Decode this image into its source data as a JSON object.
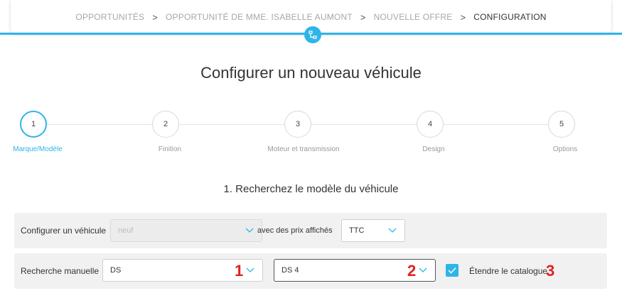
{
  "breadcrumb": {
    "items": [
      "OPPORTUNITÉS",
      "OPPORTUNITÉ DE MME. ISABELLE AUMONT",
      "NOUVELLE OFFRE",
      "CONFIGURATION"
    ],
    "separator": ">"
  },
  "page": {
    "title": "Configurer un nouveau véhicule"
  },
  "stepper": {
    "steps": [
      {
        "number": "1",
        "label": "Marque/Modèle",
        "active": true
      },
      {
        "number": "2",
        "label": "Finition",
        "active": false
      },
      {
        "number": "3",
        "label": "Moteur et transmission",
        "active": false
      },
      {
        "number": "4",
        "label": "Design",
        "active": false
      },
      {
        "number": "5",
        "label": "Options",
        "active": false
      }
    ]
  },
  "section": {
    "title": "1. Recherchez le modèle du véhicule"
  },
  "config_row": {
    "label": "Configurer un véhicule",
    "condition_select": {
      "value": "neuf",
      "disabled": true
    },
    "price_label": "avec des prix affichés",
    "price_select": {
      "value": "TTC"
    }
  },
  "search_row": {
    "label": "Recherche manuelle",
    "brand_select": {
      "value": "DS"
    },
    "model_select": {
      "value": "DS 4"
    },
    "extend_catalog": {
      "label": "Étendre le catalogue",
      "checked": true
    },
    "markers": [
      "1",
      "2",
      "3"
    ]
  },
  "colors": {
    "accent": "#2fb4e8",
    "marker": "#e02020"
  },
  "icons": {
    "top_node": "sitemap-icon",
    "dropdown": "chevron-down-icon",
    "checkbox": "checkmark-icon"
  }
}
